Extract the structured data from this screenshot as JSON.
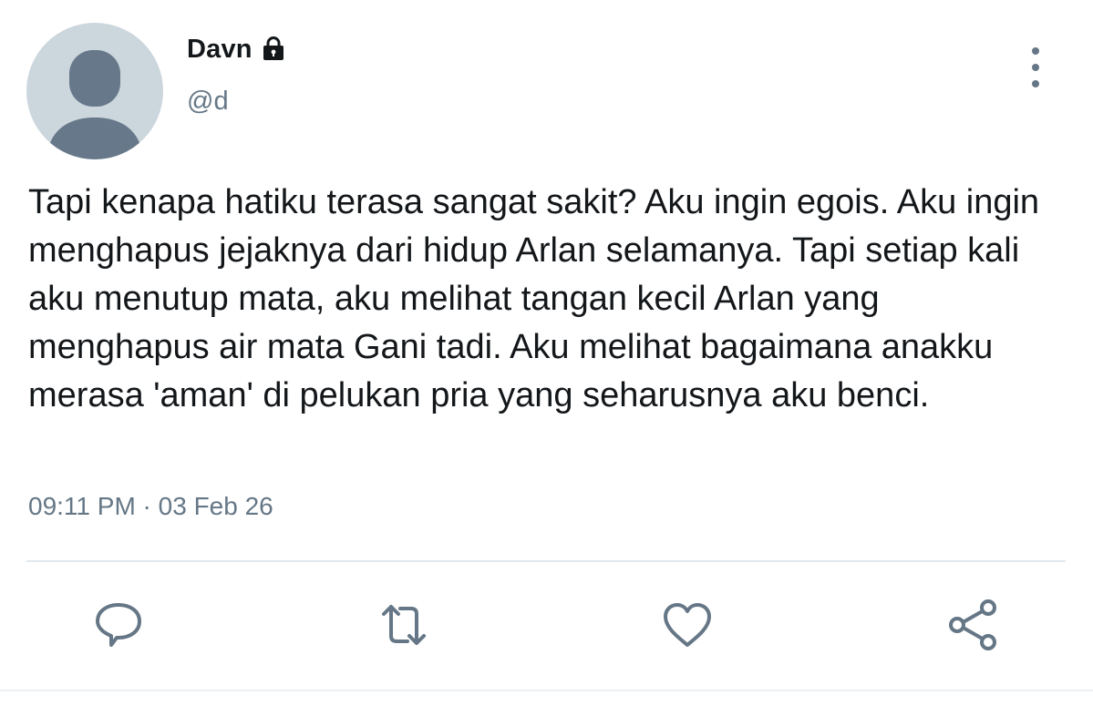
{
  "user": {
    "display_name": "Davn",
    "handle": "@d",
    "protected_icon": "lock-icon",
    "avatar_icon": "default-avatar"
  },
  "tweet": {
    "text": "Tapi kenapa hatiku terasa sangat sakit? Aku ingin egois. Aku ingin menghapus jejaknya dari hidup Arlan selamanya. Tapi setiap kali aku menutup mata, aku melihat tangan kecil Arlan yang menghapus air mata Gani tadi. Aku melihat bagaimana anakku merasa 'aman' di pelukan pria yang seharusnya aku benci.",
    "timestamp": "09:11 PM · 03 Feb 26"
  },
  "actions": {
    "reply_icon": "reply-icon",
    "retweet_icon": "retweet-icon",
    "like_icon": "heart-icon",
    "share_icon": "share-icon",
    "more_icon": "more-vertical-icon"
  },
  "colors": {
    "text_primary": "#14171a",
    "text_secondary": "#657786",
    "avatar_bg": "#ccd6dd",
    "avatar_fg": "#66788a",
    "divider": "#e1e8ed"
  }
}
